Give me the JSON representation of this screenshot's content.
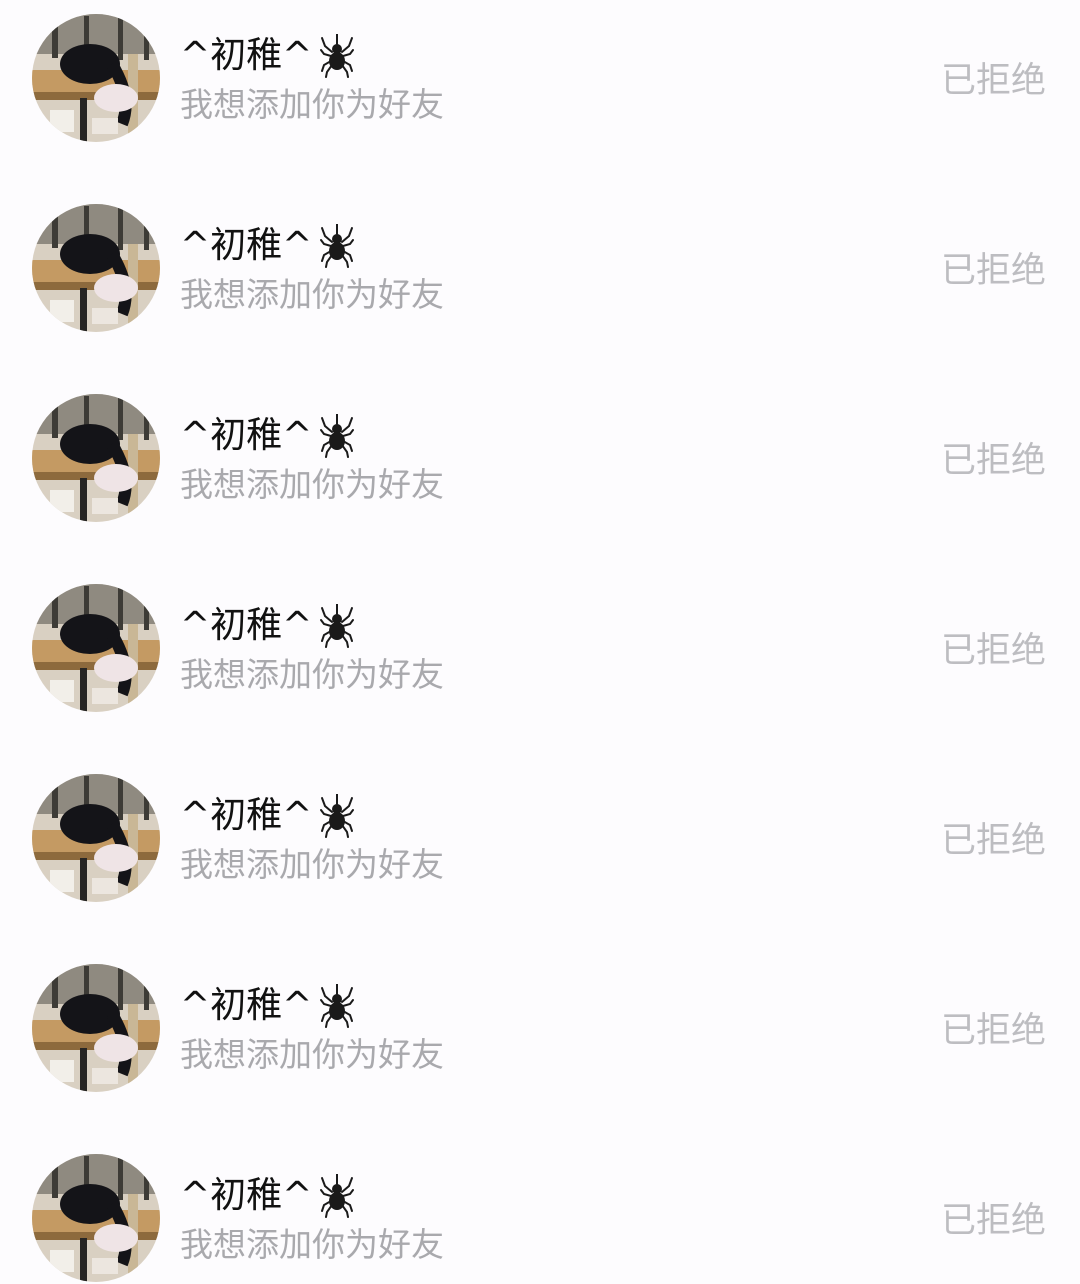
{
  "requests": [
    {
      "avatar": "avatar-photo",
      "name": "^初稚^",
      "name_icon": "spider-icon",
      "message": "我想添加你为好友",
      "status": "已拒绝"
    },
    {
      "avatar": "avatar-photo",
      "name": "^初稚^",
      "name_icon": "spider-icon",
      "message": "我想添加你为好友",
      "status": "已拒绝"
    },
    {
      "avatar": "avatar-photo",
      "name": "^初稚^",
      "name_icon": "spider-icon",
      "message": "我想添加你为好友",
      "status": "已拒绝"
    },
    {
      "avatar": "avatar-photo",
      "name": "^初稚^",
      "name_icon": "spider-icon",
      "message": "我想添加你为好友",
      "status": "已拒绝"
    },
    {
      "avatar": "avatar-photo",
      "name": "^初稚^",
      "name_icon": "spider-icon",
      "message": "我想添加你为好友",
      "status": "已拒绝"
    },
    {
      "avatar": "avatar-photo",
      "name": "^初稚^",
      "name_icon": "spider-icon",
      "message": "我想添加你为好友",
      "status": "已拒绝"
    },
    {
      "avatar": "avatar-photo",
      "name": "^初稚^",
      "name_icon": "spider-icon",
      "message": "我想添加你为好友",
      "status": "已拒绝"
    }
  ],
  "colors": {
    "background": "#fdfcfe",
    "name_text": "#111111",
    "message_text": "#a9a9ad",
    "status_text": "#bdbdc1"
  }
}
